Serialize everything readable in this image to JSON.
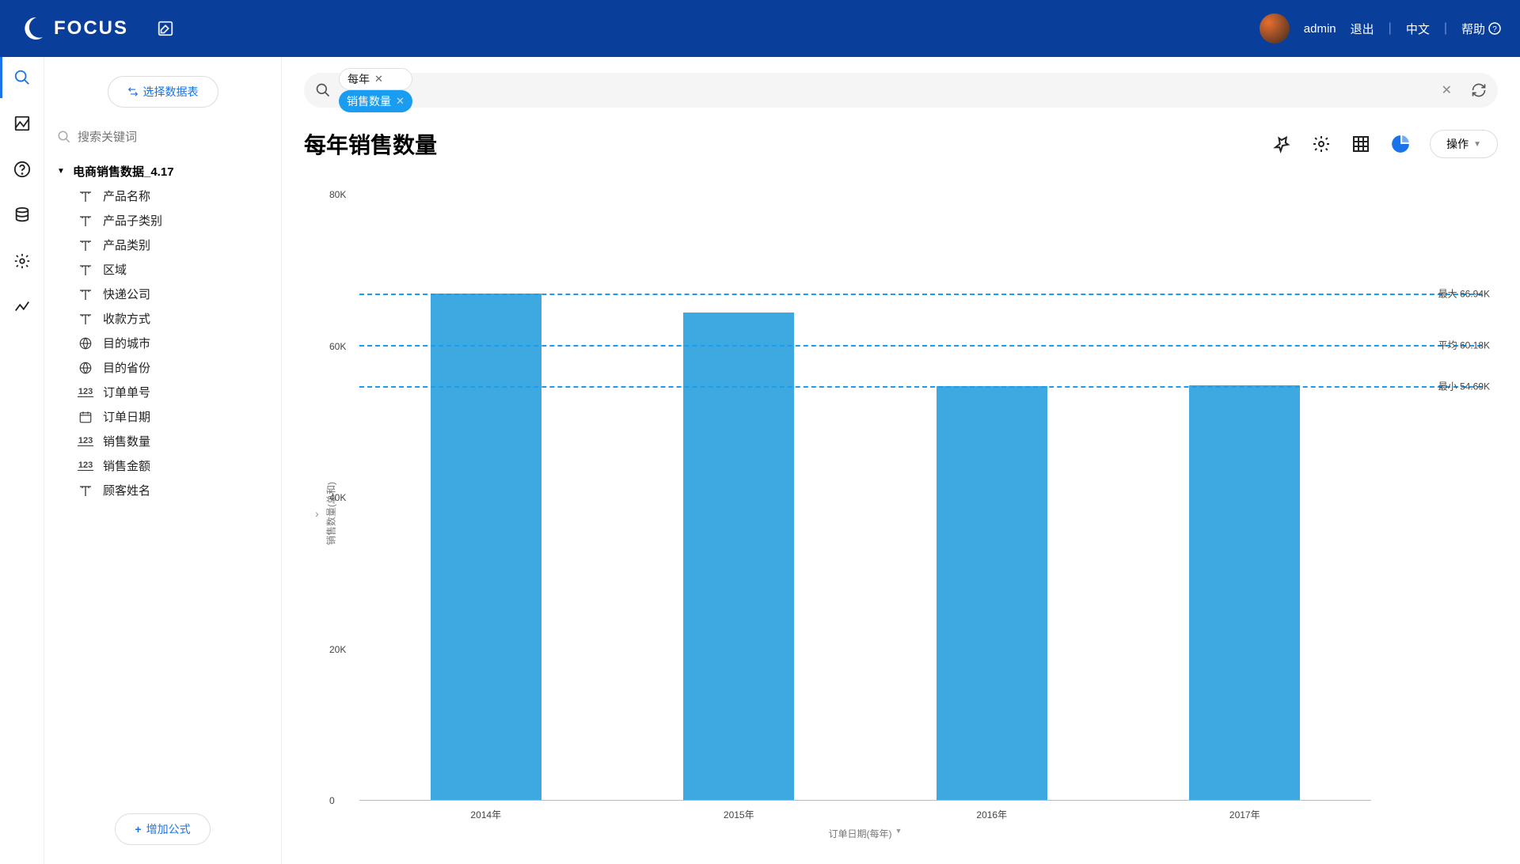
{
  "header": {
    "brand": "FOCUS",
    "user": "admin",
    "logout": "退出",
    "lang": "中文",
    "help": "帮助"
  },
  "sidebar": {
    "select_table": "选择数据表",
    "search_placeholder": "搜索关键词",
    "table_name": "电商销售数据_4.17",
    "fields": [
      {
        "icon": "text",
        "label": "产品名称"
      },
      {
        "icon": "text",
        "label": "产品子类别"
      },
      {
        "icon": "text",
        "label": "产品类别"
      },
      {
        "icon": "text",
        "label": "区域"
      },
      {
        "icon": "text",
        "label": "快递公司"
      },
      {
        "icon": "text",
        "label": "收款方式"
      },
      {
        "icon": "geo",
        "label": "目的城市"
      },
      {
        "icon": "geo",
        "label": "目的省份"
      },
      {
        "icon": "num",
        "label": "订单单号"
      },
      {
        "icon": "date",
        "label": "订单日期"
      },
      {
        "icon": "num",
        "label": "销售数量"
      },
      {
        "icon": "num",
        "label": "销售金额"
      },
      {
        "icon": "text",
        "label": "顾客姓名"
      }
    ],
    "add_formula": "增加公式"
  },
  "searchbar": {
    "chips": [
      {
        "label": "每年",
        "style": "white"
      },
      {
        "label": "销售数量",
        "style": "blue"
      }
    ]
  },
  "page": {
    "title": "每年销售数量",
    "actions": "操作"
  },
  "chart_data": {
    "type": "bar",
    "title": "每年销售数量",
    "xlabel": "订单日期(每年)",
    "ylabel": "销售数量(总和)",
    "categories": [
      "2014年",
      "2015年",
      "2016年",
      "2017年"
    ],
    "values": [
      66940,
      64400,
      54690,
      54800
    ],
    "ylim": [
      0,
      80000
    ],
    "yticks": [
      0,
      20000,
      40000,
      60000,
      80000
    ],
    "ytick_labels": [
      "0",
      "20K",
      "40K",
      "60K",
      "80K"
    ],
    "reference_lines": [
      {
        "key": "最大",
        "value": 66940,
        "label": "最大 66.94K"
      },
      {
        "key": "平均",
        "value": 60180,
        "label": "平均 60.18K"
      },
      {
        "key": "最小",
        "value": 54690,
        "label": "最小 54.69K"
      }
    ]
  },
  "colors": {
    "brand": "#0a3e9b",
    "accent": "#1a73e8",
    "bar": "#3ea9e0"
  }
}
